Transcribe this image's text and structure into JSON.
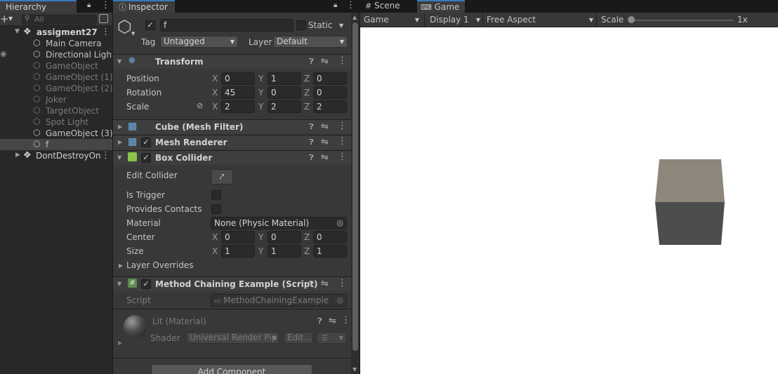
{
  "hierarchy": {
    "tab": "Hierarchy",
    "search_placeholder": "All",
    "scene": "assigment27",
    "items": [
      "Main Camera",
      "Directional Light",
      "GameObject",
      "GameObject (1)",
      "GameObject (2)",
      "Joker",
      "TargetObject",
      "Spot Light",
      "GameObject (3)",
      "f"
    ],
    "dont_destroy": "DontDestroyOn"
  },
  "inspector": {
    "tab": "Inspector",
    "name": "f",
    "static_label": "Static",
    "tag_label": "Tag",
    "tag_value": "Untagged",
    "layer_label": "Layer",
    "layer_value": "Default",
    "transform": {
      "title": "Transform",
      "position_label": "Position",
      "position": [
        "0",
        "1",
        "0"
      ],
      "rotation_label": "Rotation",
      "rotation": [
        "45",
        "0",
        "0"
      ],
      "scale_label": "Scale",
      "scale": [
        "2",
        "2",
        "2"
      ]
    },
    "axes": [
      "X",
      "Y",
      "Z"
    ],
    "mesh_filter_title": "Cube (Mesh Filter)",
    "mesh_renderer_title": "Mesh Renderer",
    "box_collider": {
      "title": "Box Collider",
      "edit_collider_label": "Edit Collider",
      "is_trigger_label": "Is Trigger",
      "provides_contacts_label": "Provides Contacts",
      "material_label": "Material",
      "material_value": "None (Physic Material)",
      "center_label": "Center",
      "center": [
        "0",
        "0",
        "0"
      ],
      "size_label": "Size",
      "size": [
        "1",
        "1",
        "1"
      ],
      "layer_overrides_label": "Layer Overrides"
    },
    "script_component": {
      "title": "Method Chaining Example (Script)",
      "script_label": "Script",
      "script_value": "MethodChainingExample"
    },
    "material": {
      "name": "Lit (Material)",
      "shader_label": "Shader",
      "shader_value": "Universal Render Pip",
      "edit_label": "Edit..."
    },
    "add_component": "Add Component"
  },
  "game": {
    "tab_scene": "Scene",
    "tab_game": "Game",
    "mode": "Game",
    "display": "Display 1",
    "aspect": "Free Aspect",
    "scale_label": "Scale",
    "scale_value": "1x",
    "colors": {
      "cube_top": "#8d867a",
      "cube_front": "#4d4d4d",
      "background": "#ffffff"
    }
  }
}
